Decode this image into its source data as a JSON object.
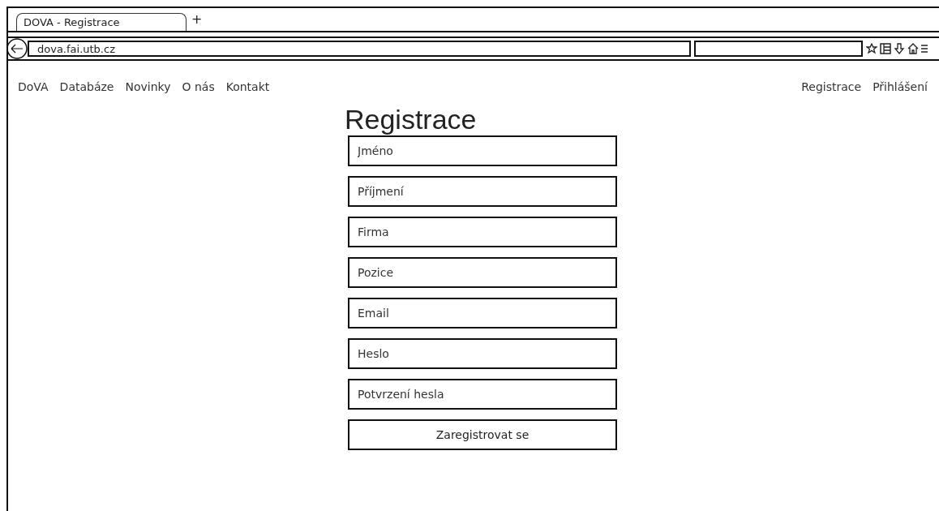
{
  "browser": {
    "tab_title": "DOVA - Registrace",
    "new_tab": "+",
    "url": "dova.fai.utb.cz"
  },
  "nav": {
    "left": [
      {
        "label": "DoVA"
      },
      {
        "label": "Databáze"
      },
      {
        "label": "Novinky"
      },
      {
        "label": "O nás"
      },
      {
        "label": "Kontakt"
      }
    ],
    "right": [
      {
        "label": "Registrace"
      },
      {
        "label": "Přihlášení"
      }
    ]
  },
  "form": {
    "title": "Registrace",
    "fields": [
      {
        "placeholder": "Jméno"
      },
      {
        "placeholder": "Příjmení"
      },
      {
        "placeholder": "Firma"
      },
      {
        "placeholder": "Pozice"
      },
      {
        "placeholder": "Email"
      },
      {
        "placeholder": "Heslo"
      },
      {
        "placeholder": "Potvrzení hesla"
      }
    ],
    "submit": "Zaregistrovat se"
  }
}
